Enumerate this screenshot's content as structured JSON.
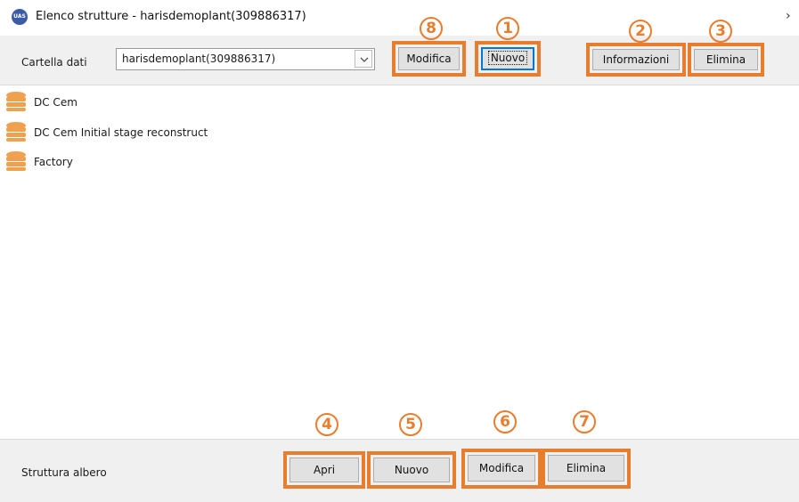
{
  "window": {
    "title": "Elenco strutture - harisdemoplant(309886317)",
    "app_icon_text": "UAS",
    "close_glyph": "×"
  },
  "top_toolbar": {
    "folder_label": "Cartella dati",
    "folder_value": "harisdemoplant(309886317)",
    "buttons": {
      "modifica": "Modifica",
      "nuovo": "Nuovo",
      "informazioni": "Informazioni",
      "elimina": "Elimina"
    }
  },
  "structures": [
    {
      "label": "DC Cem",
      "icon": "database-icon"
    },
    {
      "label": "DC Cem Initial stage reconstruct",
      "icon": "database-icon"
    },
    {
      "label": "Factory",
      "icon": "database-icon"
    }
  ],
  "bottom_toolbar": {
    "label": "Struttura albero",
    "buttons": {
      "apri": "Apri",
      "nuovo": "Nuovo",
      "modifica": "Modifica",
      "elimina": "Elimina"
    }
  },
  "badges": {
    "b1": "1",
    "b2": "2",
    "b3": "3",
    "b4": "4",
    "b5": "5",
    "b6": "6",
    "b7": "7",
    "b8": "8"
  },
  "colors": {
    "highlight": "#e87d2e",
    "db_icon": "#f0a150"
  }
}
